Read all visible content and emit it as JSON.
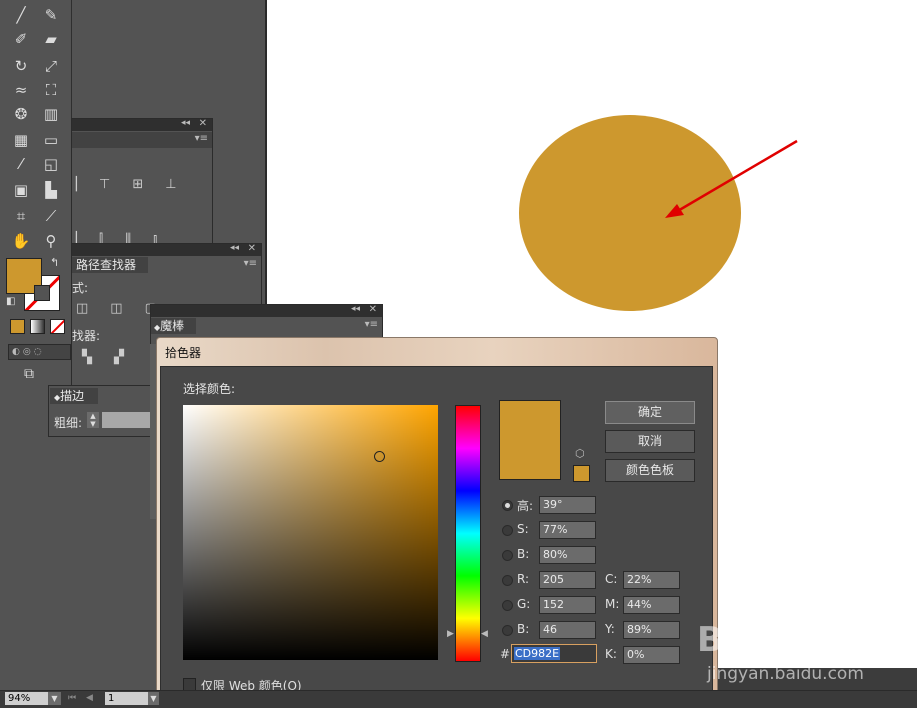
{
  "colors": {
    "fill": "#CD982E",
    "arrow": "#e00000",
    "artboard": "#ffffff",
    "workspace": "#535353"
  },
  "toolbar": {
    "tools": [
      "paintbrush-icon",
      "pencil-icon",
      "blob-brush-icon",
      "eraser-icon",
      "rotate-icon",
      "scale-icon",
      "warp-icon",
      "free-transform-icon",
      "symbol-sprayer-icon",
      "column-graph-icon",
      "mesh-icon",
      "gradient-icon",
      "eyedropper-icon",
      "blend-icon",
      "live-paint-icon",
      "chart-icon",
      "artboard-icon",
      "slice-icon",
      "hand-icon",
      "zoom-icon"
    ]
  },
  "align_panel": {
    "labels": [
      "",
      ""
    ]
  },
  "pathfinder_panel": {
    "tab": "路径查找器",
    "mode_label": "式:",
    "finder_label": "找器:"
  },
  "magic_wand_panel": {
    "tab": "魔棒"
  },
  "stroke_panel": {
    "tab": "描边",
    "weight_label": "粗细:"
  },
  "color_picker": {
    "title": "拾色器",
    "select_color_label": "选择颜色:",
    "ok": "确定",
    "cancel": "取消",
    "swatches": "颜色色板",
    "fields": {
      "H": {
        "label": "高:",
        "value": "39°"
      },
      "S": {
        "label": "S:",
        "value": "77%"
      },
      "B": {
        "label": "B:",
        "value": "80%"
      },
      "R": {
        "label": "R:",
        "value": "205"
      },
      "G": {
        "label": "G:",
        "value": "152"
      },
      "Bl": {
        "label": "B:",
        "value": "46"
      },
      "C": {
        "label": "C:",
        "value": "22%"
      },
      "M": {
        "label": "M:",
        "value": "44%"
      },
      "Y": {
        "label": "Y:",
        "value": "89%"
      },
      "K": {
        "label": "K:",
        "value": "0%"
      }
    },
    "hex_label": "#",
    "hex_value": "CD982E",
    "web_only_label": "仅限 Web 颜色(O)"
  },
  "statusbar": {
    "zoom": "94%",
    "page": "1"
  },
  "watermark": {
    "logo": "Bai du 经验",
    "url": "jingyan.baidu.com"
  }
}
